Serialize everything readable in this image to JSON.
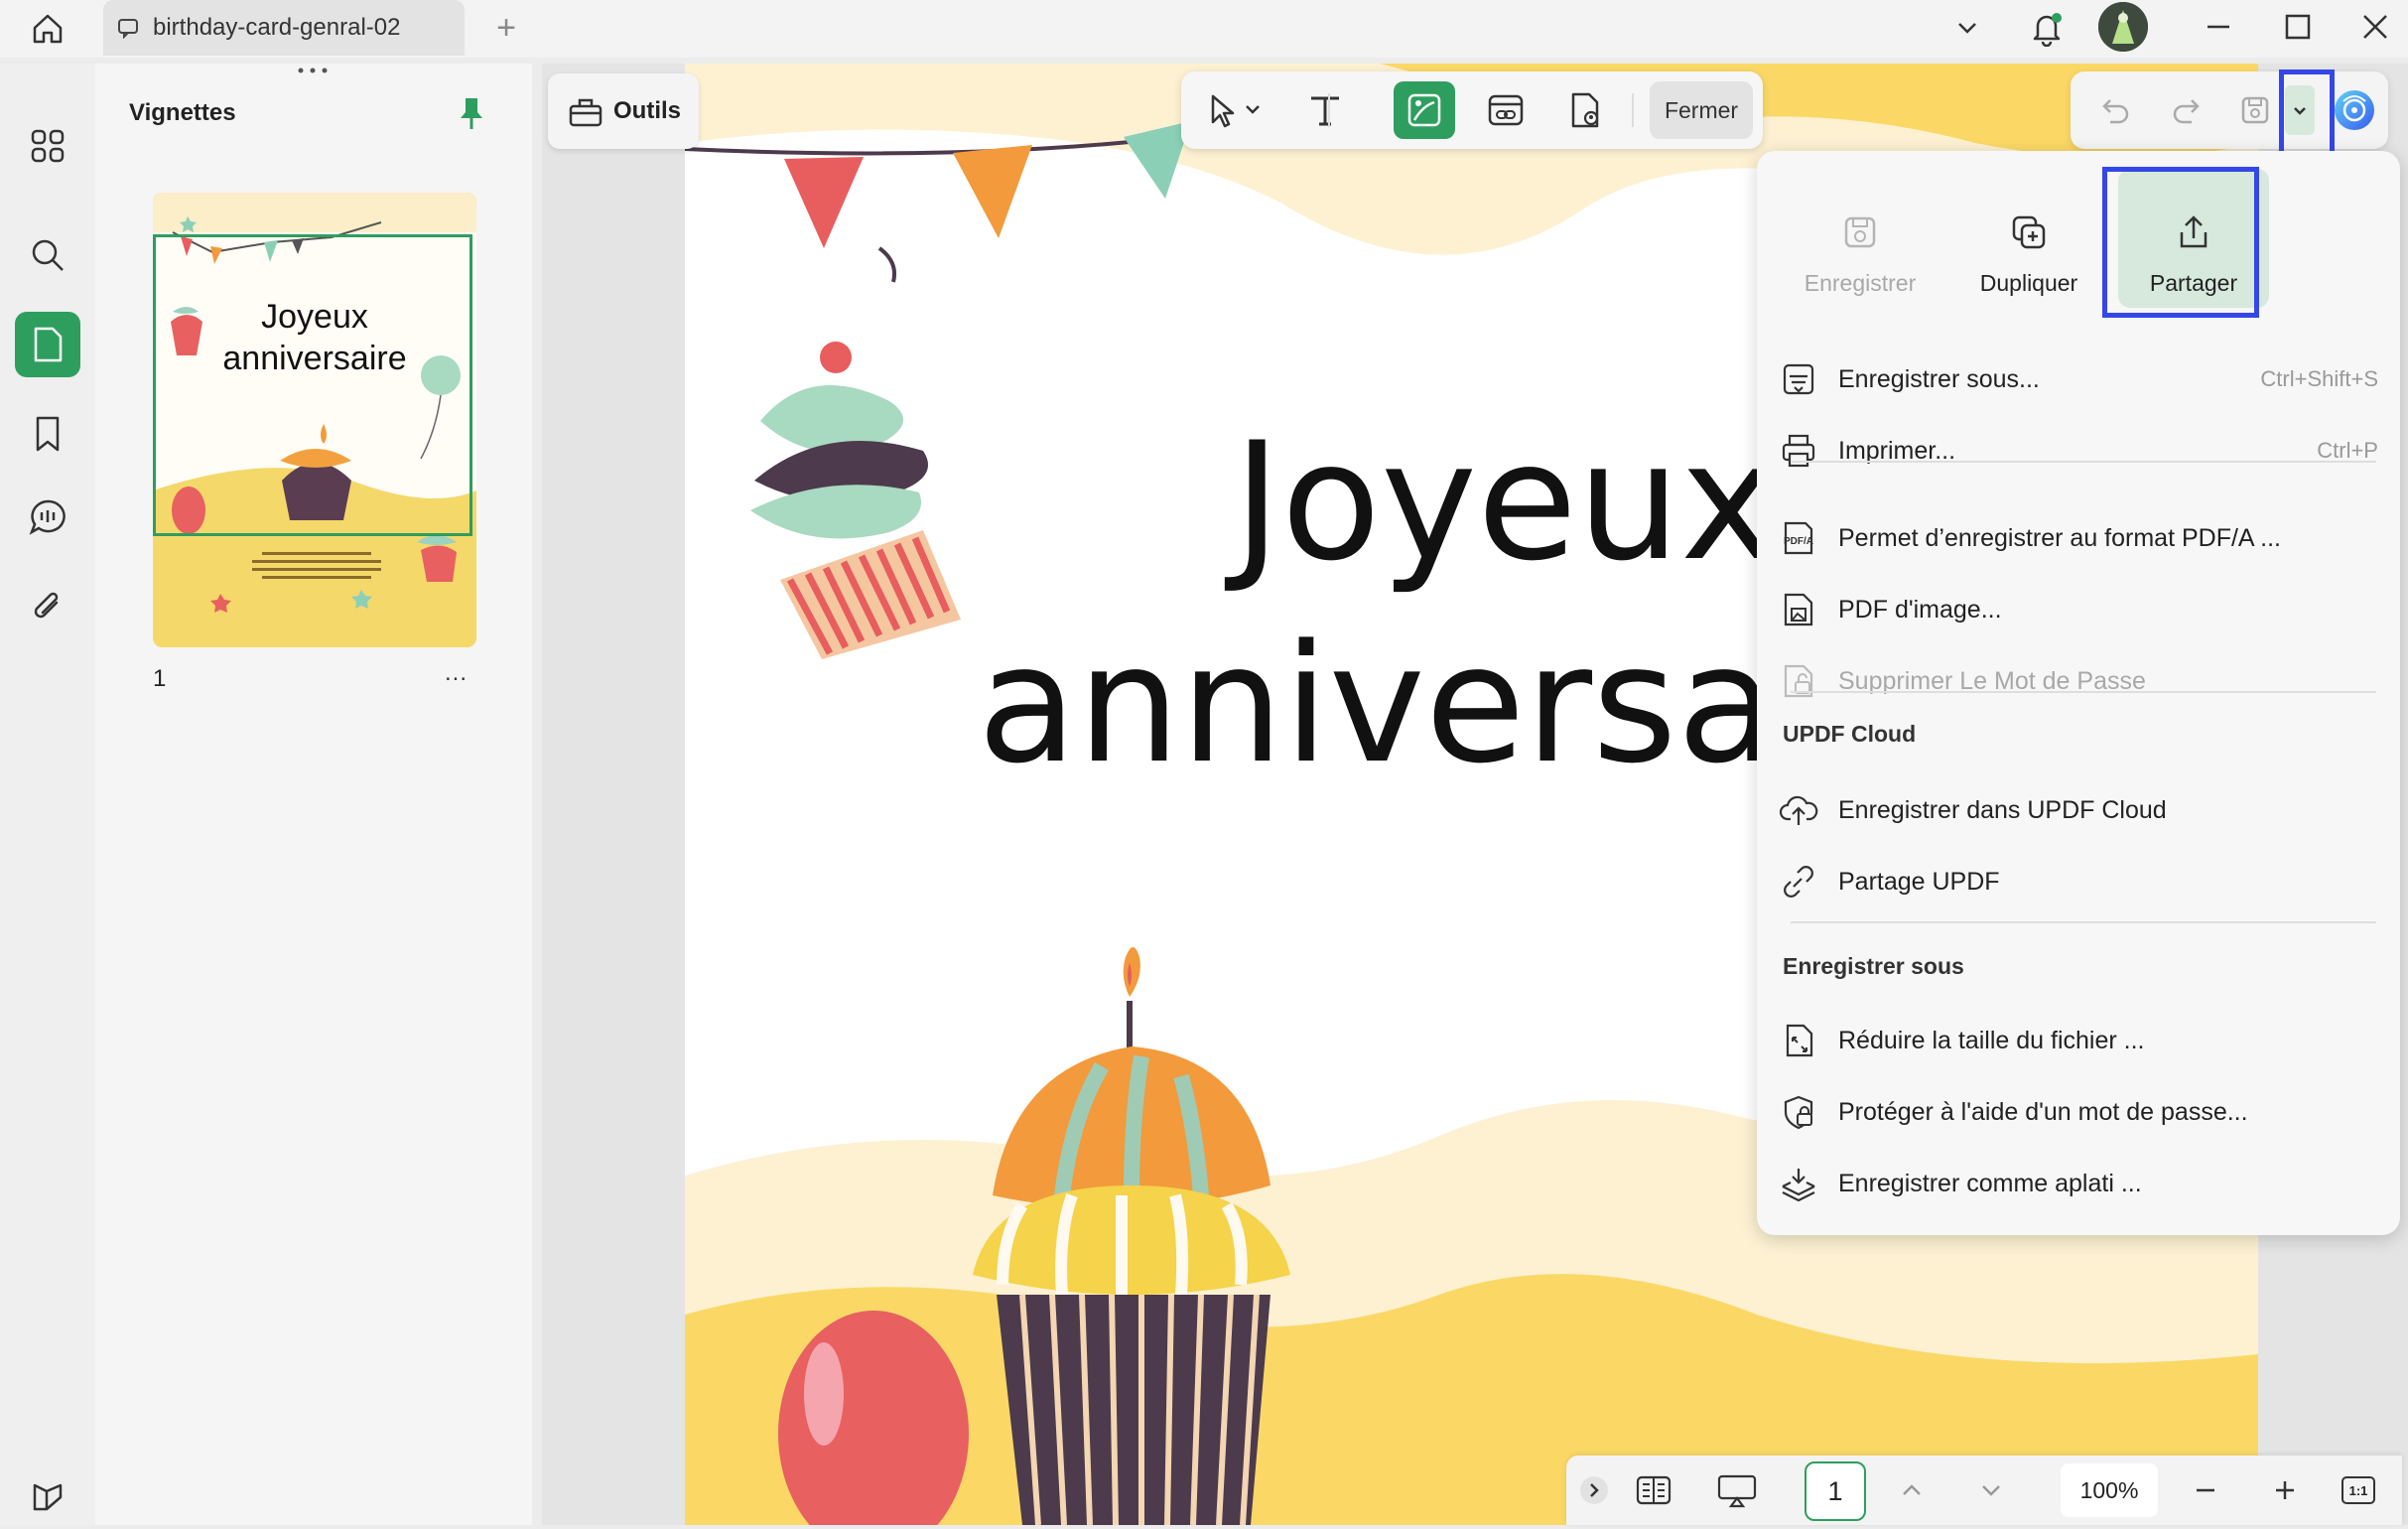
{
  "tab": {
    "title": "birthday-card-genral-02",
    "new_tab_symbol": "+"
  },
  "thumbnails": {
    "title": "Vignettes",
    "page_label": "1",
    "more": "...",
    "thumb_heading_line1": "Joyeux",
    "thumb_heading_line2": "anniversaire"
  },
  "tools": {
    "label": "Outils"
  },
  "toolbar": {
    "close_label": "Fermer"
  },
  "page": {
    "heading_line1": "Joyeux",
    "heading_line2": "anniversa"
  },
  "menu": {
    "top": [
      {
        "label": "Enregistrer",
        "disabled": true
      },
      {
        "label": "Dupliquer",
        "disabled": false
      },
      {
        "label": "Partager",
        "disabled": false
      }
    ],
    "items1": [
      {
        "label": "Enregistrer sous...",
        "shortcut": "Ctrl+Shift+S"
      },
      {
        "label": "Imprimer...",
        "shortcut": "Ctrl+P"
      }
    ],
    "items2": [
      {
        "label": "Permet d’enregistrer au format PDF/A ...",
        "icon_text": "PDF/A"
      },
      {
        "label": "PDF d'image..."
      },
      {
        "label": "Supprimer Le Mot de Passe",
        "disabled": true
      }
    ],
    "section_cloud": "UPDF Cloud",
    "items3": [
      {
        "label": "Enregistrer dans UPDF Cloud"
      },
      {
        "label": "Partage UPDF"
      }
    ],
    "section_save": "Enregistrer sous",
    "items4": [
      {
        "label": "Réduire la taille du fichier ..."
      },
      {
        "label": "Protéger à l'aide d'un mot de passe..."
      },
      {
        "label": "Enregistrer comme aplati ..."
      }
    ]
  },
  "bottom": {
    "page_number": "1",
    "zoom": "100%",
    "fit_label": "1:1"
  },
  "colors": {
    "accent": "#2e9e5e",
    "highlight": "#3447e8",
    "yellow": "#fbd866",
    "cream": "#fdf2d4"
  }
}
